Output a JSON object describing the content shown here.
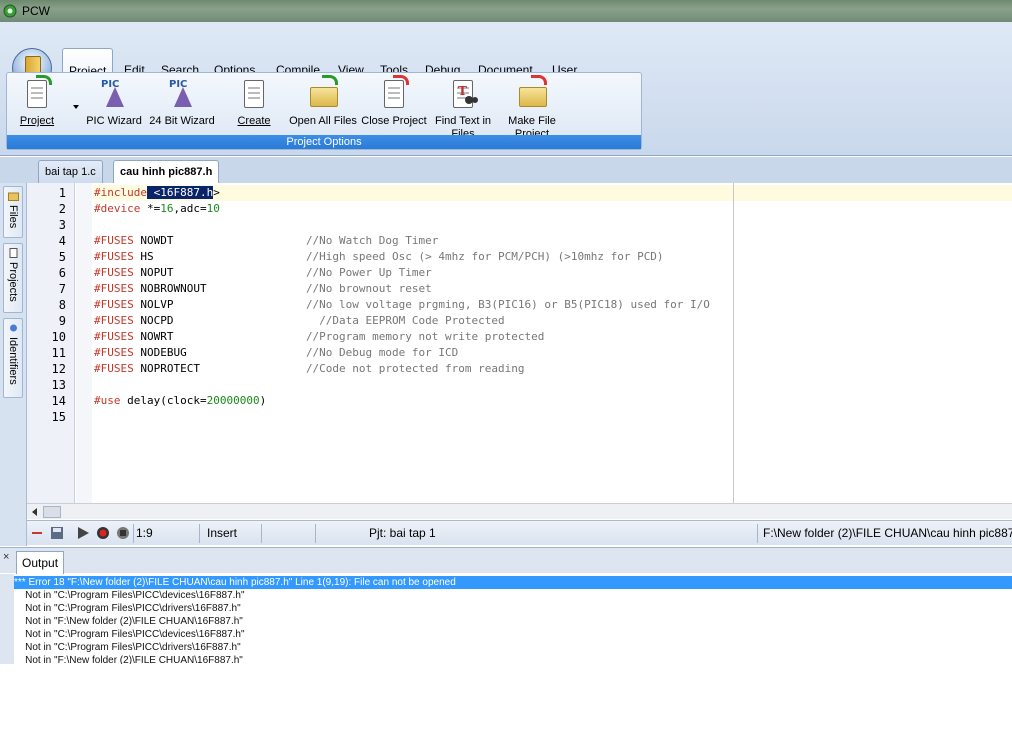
{
  "window": {
    "title": "PCW",
    "icon": "pcw-app-icon"
  },
  "menu": {
    "items": [
      {
        "label": "Project",
        "active": true
      },
      {
        "label": "Edit"
      },
      {
        "label": "Search"
      },
      {
        "label": "Options"
      },
      {
        "label": "Compile"
      },
      {
        "label": "View"
      },
      {
        "label": "Tools"
      },
      {
        "label": "Debug"
      },
      {
        "label": "Document"
      },
      {
        "label": "User Toolbar"
      }
    ]
  },
  "ribbon": {
    "group_caption": "Project Options",
    "tools": [
      {
        "label": "Project",
        "icon": "project-icon"
      },
      {
        "label": "PIC Wizard",
        "icon": "pic-wizard-icon"
      },
      {
        "label": "24 Bit Wizard",
        "icon": "24-bit-wizard-icon"
      },
      {
        "label": "Create",
        "icon": "create-icon"
      },
      {
        "label": "Open All Files",
        "icon": "open-all-files-icon"
      },
      {
        "label": "Close Project",
        "icon": "close-project-icon"
      },
      {
        "label": "Find Text in\nFiles",
        "icon": "find-text-icon"
      },
      {
        "label": "Make File\nProject",
        "icon": "make-file-project-icon"
      }
    ],
    "wizard_badge": "PIC"
  },
  "doc_tabs": [
    {
      "label": "bai tap 1.c",
      "active": false
    },
    {
      "label": "cau hinh pic887.h",
      "active": true
    }
  ],
  "side_tabs": [
    {
      "label": "Files"
    },
    {
      "label": "Projects"
    },
    {
      "label": "Identifiers"
    }
  ],
  "editor": {
    "line_numbers": [
      "1",
      "2",
      "3",
      "4",
      "5",
      "6",
      "7",
      "8",
      "9",
      "10",
      "11",
      "12",
      "13",
      "14",
      "15"
    ],
    "lines": {
      "l1": {
        "kw": "#include",
        "sel": " <16F887.h",
        "rest": ">"
      },
      "l2": {
        "kw": "#device",
        "rest_a": " *=",
        "n1": "16",
        "rest_b": ",adc=",
        "n2": "10"
      },
      "l4": {
        "kw": "#FUSES",
        "opt": " NOWDT                    ",
        "cmt": "//No Watch Dog Timer"
      },
      "l5": {
        "kw": "#FUSES",
        "opt": " HS                       ",
        "cmt": "//High speed Osc (> 4mhz for PCM/PCH) (>10mhz for PCD)"
      },
      "l6": {
        "kw": "#FUSES",
        "opt": " NOPUT                    ",
        "cmt": "//No Power Up Timer"
      },
      "l7": {
        "kw": "#FUSES",
        "opt": " NOBROWNOUT               ",
        "cmt": "//No brownout reset"
      },
      "l8": {
        "kw": "#FUSES",
        "opt": " NOLVP                    ",
        "cmt": "//No low voltage prgming, B3(PIC16) or B5(PIC18) used for I/O"
      },
      "l9": {
        "kw": "#FUSES",
        "opt": " NOCPD                      ",
        "cmt": "//Data EEPROM Code Protected"
      },
      "l10": {
        "kw": "#FUSES",
        "opt": " NOWRT                    ",
        "cmt": "//Program memory not write protected"
      },
      "l11": {
        "kw": "#FUSES",
        "opt": " NODEBUG                  ",
        "cmt": "//No Debug mode for ICD"
      },
      "l12": {
        "kw": "#FUSES",
        "opt": " NOPROTECT                ",
        "cmt": "//Code not protected from reading"
      },
      "l14": {
        "kw": "#use",
        "rest_a": " delay(clock=",
        "n1": "20000000",
        "rest_b": ")"
      }
    }
  },
  "status": {
    "position": "1:9",
    "mode": "Insert",
    "project": "Pjt: bai tap 1",
    "path": "F:\\New folder (2)\\FILE CHUAN\\cau hinh pic887"
  },
  "output": {
    "tab_label": "Output",
    "close_glyph": "×",
    "lines": [
      "*** Error 18 \"F:\\New folder (2)\\FILE CHUAN\\cau hinh pic887.h\" Line 1(9,19): File can not be opened",
      "    Not in \"C:\\Program Files\\PICC\\devices\\16F887.h\"",
      "    Not in \"C:\\Program Files\\PICC\\drivers\\16F887.h\"",
      "    Not in \"F:\\New folder (2)\\FILE CHUAN\\16F887.h\"",
      "    Not in \"C:\\Program Files\\PICC\\devices\\16F887.h\"",
      "    Not in \"C:\\Program Files\\PICC\\drivers\\16F887.h\"",
      "    Not in \"F:\\New folder (2)\\FILE CHUAN\\16F887.h\""
    ]
  },
  "colors": {
    "selection": "#0a246a",
    "error_highlight": "#3399ff",
    "keyword": "#c0392b",
    "number": "#1a8a1a",
    "comment": "#777777"
  }
}
